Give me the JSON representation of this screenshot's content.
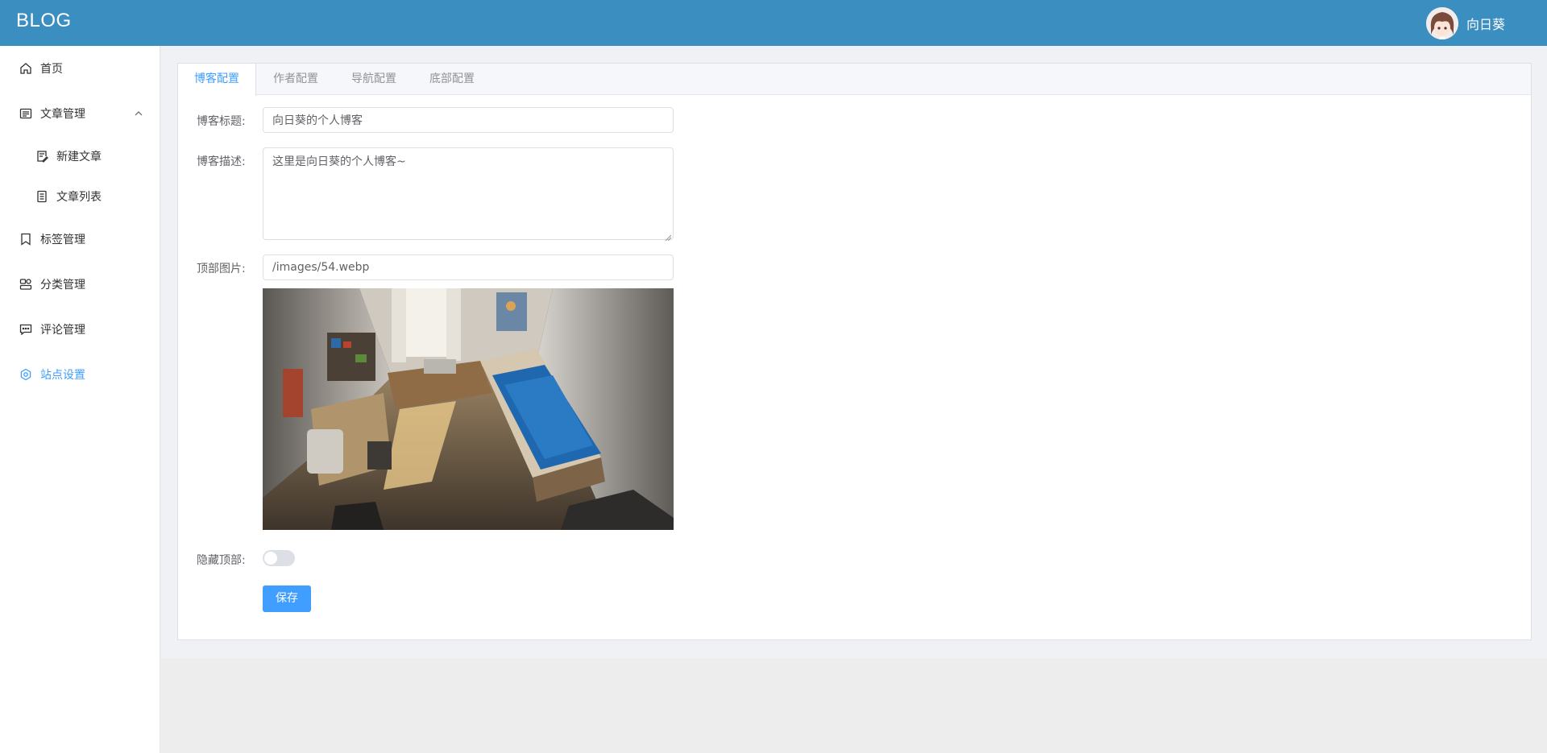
{
  "header": {
    "brand": "BLOG",
    "username": "向日葵"
  },
  "sidebar": {
    "items": [
      {
        "label": "首页",
        "icon": "home-icon"
      },
      {
        "label": "文章管理",
        "icon": "article-manage-icon",
        "expanded": true
      },
      {
        "label": "新建文章",
        "icon": "edit-document-icon"
      },
      {
        "label": "文章列表",
        "icon": "document-list-icon"
      },
      {
        "label": "标签管理",
        "icon": "tag-icon"
      },
      {
        "label": "分类管理",
        "icon": "category-icon"
      },
      {
        "label": "评论管理",
        "icon": "comment-icon"
      },
      {
        "label": "站点设置",
        "icon": "settings-icon",
        "active": true
      }
    ]
  },
  "tabs": [
    {
      "label": "博客配置",
      "active": true
    },
    {
      "label": "作者配置"
    },
    {
      "label": "导航配置"
    },
    {
      "label": "底部配置"
    }
  ],
  "form": {
    "title_label": "博客标题:",
    "title_value": "向日葵的个人博客",
    "desc_label": "博客描述:",
    "desc_value": "这里是向日葵的个人博客~",
    "image_label": "顶部图片:",
    "image_value": "/images/54.webp",
    "hide_label": "隐藏顶部:",
    "hide_value": false,
    "save_label": "保存"
  },
  "colors": {
    "header_bg": "#3a8ec0",
    "accent": "#409eff"
  }
}
